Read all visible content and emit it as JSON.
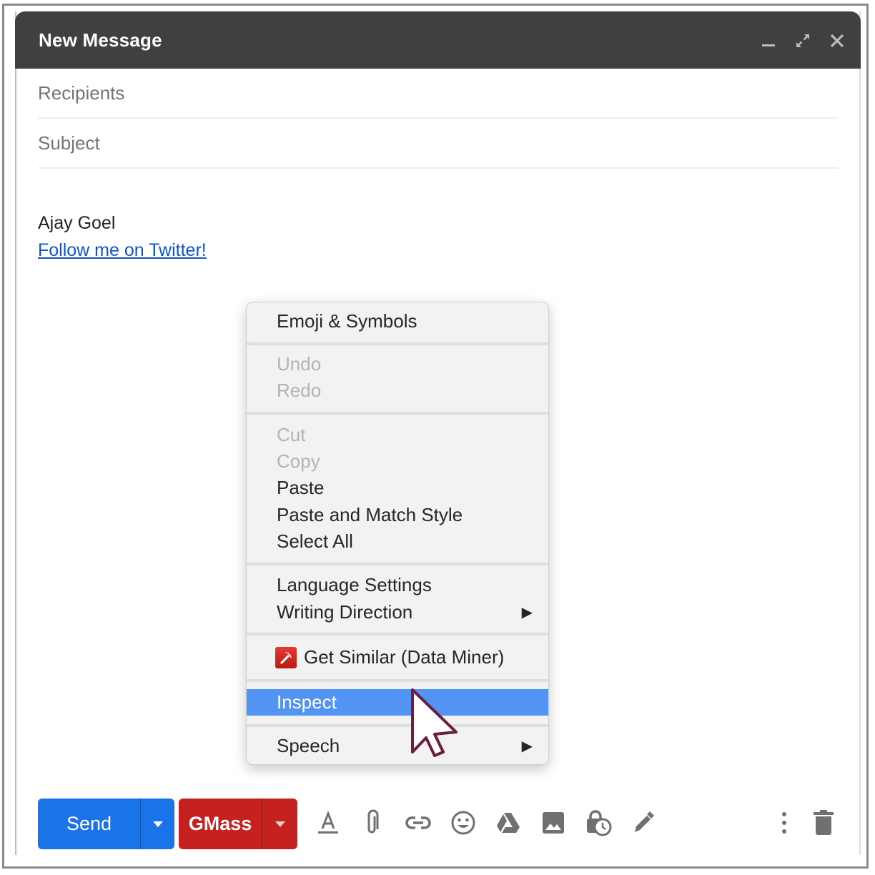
{
  "window": {
    "title": "New Message",
    "controls": {
      "minimize": "minimize-icon",
      "expand": "expand-icon",
      "close": "close-icon"
    }
  },
  "fields": {
    "recipients_placeholder": "Recipients",
    "recipients_value": "",
    "subject_placeholder": "Subject",
    "subject_value": ""
  },
  "body": {
    "signature_name": "Ajay Goel",
    "signature_link": "Follow me on Twitter!"
  },
  "context_menu": {
    "groups": [
      [
        {
          "label": "Emoji & Symbols",
          "enabled": true
        }
      ],
      [
        {
          "label": "Undo",
          "enabled": false
        },
        {
          "label": "Redo",
          "enabled": false
        }
      ],
      [
        {
          "label": "Cut",
          "enabled": false
        },
        {
          "label": "Copy",
          "enabled": false
        },
        {
          "label": "Paste",
          "enabled": true
        },
        {
          "label": "Paste and Match Style",
          "enabled": true
        },
        {
          "label": "Select All",
          "enabled": true
        }
      ],
      [
        {
          "label": "Language Settings",
          "enabled": true
        },
        {
          "label": "Writing Direction",
          "enabled": true,
          "submenu": true
        }
      ],
      [
        {
          "label": "Get Similar (Data Miner)",
          "enabled": true,
          "icon": "pickaxe-icon"
        }
      ],
      [
        {
          "label": "Inspect",
          "enabled": true,
          "highlighted": true
        }
      ],
      [
        {
          "label": "Speech",
          "enabled": true,
          "submenu": true
        }
      ]
    ],
    "submenu_glyph": "▶",
    "highlight_color": "#5393f4"
  },
  "toolbar": {
    "send_label": "Send",
    "gmass_label": "GMass",
    "send_color": "#1a73e8",
    "gmass_color": "#c5221f",
    "icons": [
      "formatting-icon",
      "attach-icon",
      "link-icon",
      "emoji-icon",
      "drive-icon",
      "photo-icon",
      "confidential-mode-icon",
      "signature-icon",
      "more-options-icon",
      "discard-icon"
    ]
  }
}
